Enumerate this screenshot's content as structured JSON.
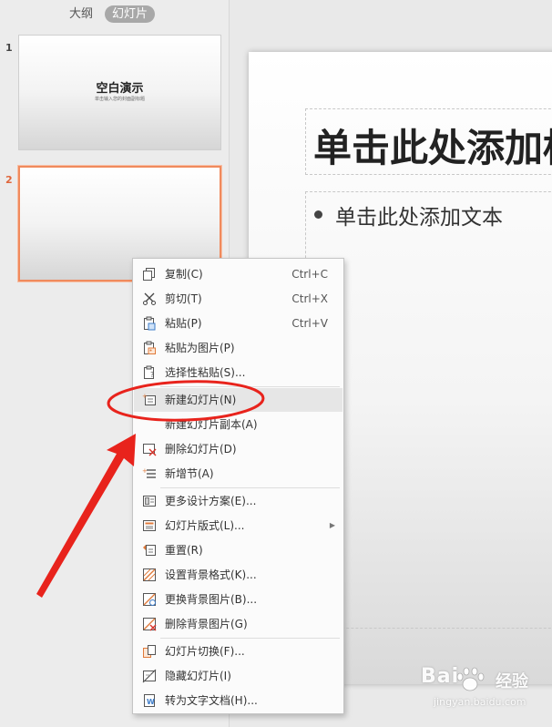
{
  "left_panel": {
    "tabs": [
      {
        "label": "大纲"
      },
      {
        "label": "幻灯片"
      }
    ],
    "thumbnails": [
      {
        "number": "1",
        "title": "空白演示",
        "subtitle": "单击输入您的封面副标题"
      },
      {
        "number": "2"
      }
    ]
  },
  "slide": {
    "title_placeholder": "单击此处添加标题",
    "body_placeholder": "单击此处添加文本"
  },
  "context_menu": {
    "items": [
      {
        "label": "复制(C)",
        "shortcut": "Ctrl+C",
        "icon": "copy-icon"
      },
      {
        "label": "剪切(T)",
        "shortcut": "Ctrl+X",
        "icon": "scissors-icon"
      },
      {
        "label": "粘贴(P)",
        "shortcut": "Ctrl+V",
        "icon": "paste-icon"
      },
      {
        "label": "粘贴为图片(P)",
        "icon": "paste-as-image-icon"
      },
      {
        "label": "选择性粘贴(S)...",
        "icon": "paste-special-icon"
      },
      {
        "label": "新建幻灯片(N)",
        "icon": "new-slide-icon",
        "highlighted": true
      },
      {
        "label": "新建幻灯片副本(A)",
        "icon": "duplicate-slide-icon"
      },
      {
        "label": "删除幻灯片(D)",
        "icon": "delete-slide-icon"
      },
      {
        "label": "新增节(A)",
        "icon": "add-section-icon"
      },
      {
        "label": "更多设计方案(E)...",
        "icon": "design-icon"
      },
      {
        "label": "幻灯片版式(L)...",
        "icon": "layout-icon",
        "submenu": true
      },
      {
        "label": "重置(R)",
        "icon": "reset-icon"
      },
      {
        "label": "设置背景格式(K)...",
        "icon": "background-format-icon"
      },
      {
        "label": "更换背景图片(B)...",
        "icon": "change-background-icon"
      },
      {
        "label": "删除背景图片(G)",
        "icon": "delete-background-icon"
      },
      {
        "label": "幻灯片切换(F)...",
        "icon": "transition-icon"
      },
      {
        "label": "隐藏幻灯片(I)",
        "icon": "hide-slide-icon"
      },
      {
        "label": "转为文字文档(H)...",
        "icon": "convert-document-icon"
      }
    ]
  },
  "annotations": {
    "color": "#e8231c",
    "circled_item": "新建幻灯片(N)"
  },
  "watermark": {
    "brand": "Bai",
    "brand_cn": "经验",
    "url": "jingyan.baidu.com"
  },
  "colors": {
    "selected_thumbnail_border": "#f08a5d",
    "selected_number": "#e0663c",
    "menu_highlight": "#e6e6e6"
  }
}
